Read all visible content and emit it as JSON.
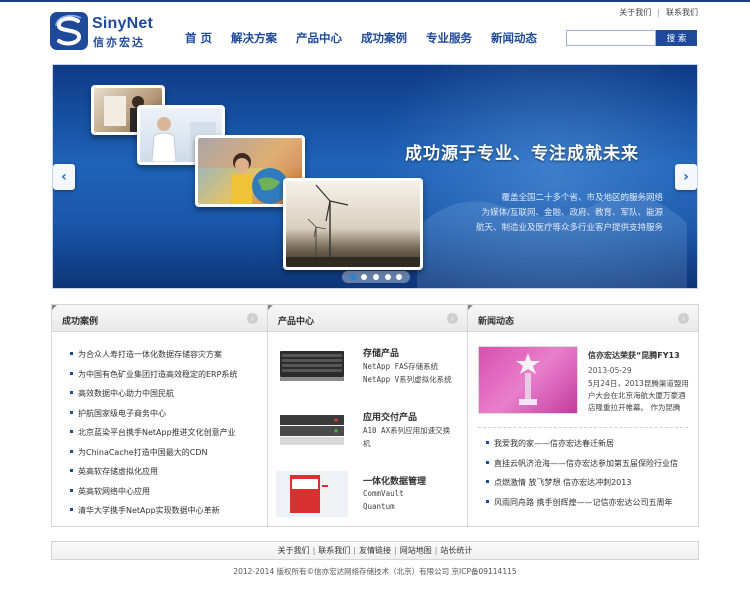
{
  "header": {
    "logo_en": "SinyNet",
    "logo_cn": "信亦宏达",
    "top_links": [
      "关于我们",
      "联系我们"
    ],
    "nav": [
      "首 页",
      "解决方案",
      "产品中心",
      "成功案例",
      "专业服务",
      "新闻动态"
    ],
    "search": {
      "placeholder": "",
      "button_label": "搜 索"
    }
  },
  "banner": {
    "slogan": "成功源于专业、专注成就未来",
    "description": [
      "覆盖全国二十多个省、市及地区的服务网络",
      "为媒体/互联网、金融、政府、教育、军队、能源",
      "航天、制造业及医疗等众多行业客户提供支持服务"
    ],
    "left_arrow": "‹",
    "right_arrow": "›",
    "slide_count": 5,
    "active_slide": 1
  },
  "cases": {
    "title": "成功案例",
    "items": [
      "为合众人寿打造一体化数据存储容灾方案",
      "为中国有色矿业集团打造高效稳定的ERP系统",
      "高效数据中心助力中国民航",
      "护航国家级电子商务中心",
      "北京蓝染平台携手NetApp推进文化创意产业",
      "为ChinaCache打造中国最大的CDN",
      "英高软存储虚拟化应用",
      "英高软网络中心应用",
      "清华大学携手NetApp实现数据中心革新"
    ]
  },
  "products": {
    "title": "产品中心",
    "items": [
      {
        "name": "存储产品",
        "lines": [
          "NetApp FAS存储系统",
          "NetApp V系列虚拟化系统"
        ]
      },
      {
        "name": "应用交付产品",
        "lines": [
          "A10 AX系列应用加速交换",
          "机"
        ]
      },
      {
        "name": "一体化数据管理",
        "lines": [
          "CommVault",
          "Quantum"
        ]
      }
    ]
  },
  "news": {
    "title": "新闻动态",
    "feature": {
      "title": "信亦宏达荣获“昆腾FY13",
      "date": "2013-05-29",
      "body": "5月24日，2013昆腾渠道盟用户大会在北京海航大厦万豪酒店隆重拉开帷幕。 作为昆腾"
    },
    "items": [
      "我爱我的家——信亦宏达春迁新居",
      "直挂云帆济沧海——信亦宏达参加第五届保险行业信",
      "点燃激情 放飞梦想 信亦宏达冲刺2013",
      "风雨同舟路 携手创辉煌——记信亦宏达公司五周年"
    ]
  },
  "footer": {
    "links": [
      "关于我们",
      "联系我们",
      "友情链接",
      "网站地图",
      "站长统计"
    ],
    "separator": "|",
    "copyright": "2012-2014 版权所有©信亦宏达网络存储技术（北京）有限公司 京ICP备09114115"
  },
  "colors": {
    "brand": "#1f4a9a",
    "banner": "#1a57aa"
  }
}
